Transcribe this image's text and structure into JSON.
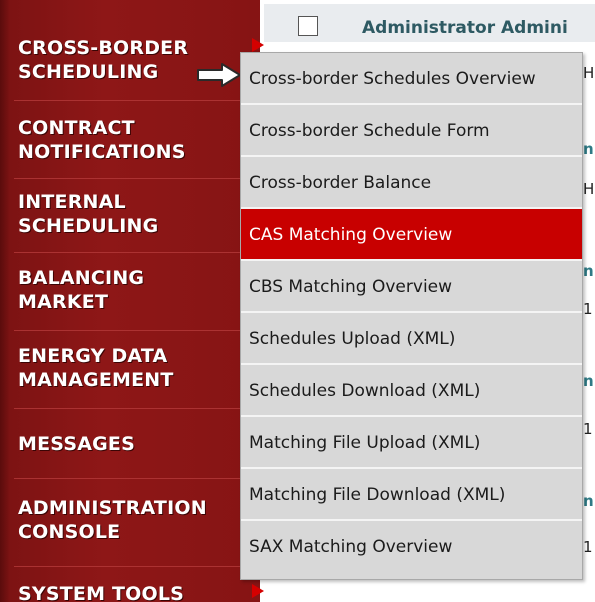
{
  "sidebar": {
    "items": [
      {
        "label": "CROSS-BORDER\nSCHEDULING"
      },
      {
        "label": "CONTRACT\nNOTIFICATIONS"
      },
      {
        "label": "INTERNAL\nSCHEDULING"
      },
      {
        "label": "BALANCING\nMARKET"
      },
      {
        "label": "ENERGY DATA\nMANAGEMENT"
      },
      {
        "label": "MESSAGES"
      },
      {
        "label": "ADMINISTRATION\nCONSOLE"
      },
      {
        "label": "SYSTEM TOOLS"
      }
    ]
  },
  "main": {
    "title": "Administrator Admini",
    "fragments": [
      "H",
      "n",
      "H",
      "n",
      "1",
      "n",
      "1",
      "n",
      "1"
    ]
  },
  "dropdown": {
    "items": [
      {
        "label": "Cross-border Schedules Overview"
      },
      {
        "label": "Cross-border Schedule Form"
      },
      {
        "label": "Cross-border Balance"
      },
      {
        "label": "CAS Matching Overview",
        "active": true
      },
      {
        "label": "CBS Matching Overview"
      },
      {
        "label": "Schedules Upload (XML)"
      },
      {
        "label": "Schedules Download (XML)"
      },
      {
        "label": "Matching File Upload (XML)"
      },
      {
        "label": "Matching File Download (XML)"
      },
      {
        "label": "SAX Matching Overview"
      }
    ]
  },
  "colors": {
    "sidebar_bg": "#861414",
    "active_bg": "#c80000",
    "menu_bg": "#d8d8d8",
    "title_color": "#2e5a63"
  },
  "icons": {
    "pointer": "arrow-right-icon",
    "submenu_marker": "triangle-right-icon"
  }
}
